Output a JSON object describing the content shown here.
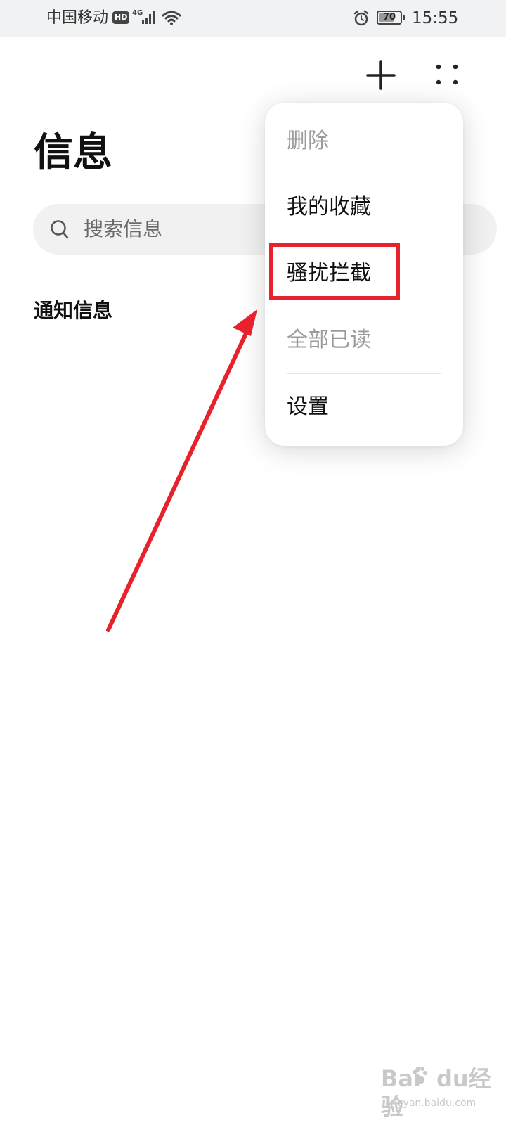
{
  "status_bar": {
    "carrier": "中国移动",
    "hd_badge": "HD",
    "network_type": "4G",
    "battery_level": "70",
    "battery_fraction": 0.7,
    "time": "15:55"
  },
  "header": {
    "add_icon": "plus-icon",
    "more_icon": "more-dots-icon"
  },
  "page": {
    "title": "信息",
    "search_placeholder": "搜索信息",
    "section_label": "通知信息"
  },
  "menu": {
    "items": [
      {
        "label": "删除",
        "enabled": false
      },
      {
        "label": "我的收藏",
        "enabled": true
      },
      {
        "label": "骚扰拦截",
        "enabled": true,
        "highlighted": true
      },
      {
        "label": "全部已读",
        "enabled": false
      },
      {
        "label": "设置",
        "enabled": true
      }
    ]
  },
  "annotation": {
    "color": "#e8222c"
  },
  "colors": {
    "text": "#111111",
    "disabled_text": "#9b9b9b",
    "search_bg": "#f1f1f1",
    "status_bar_bg": "#f1f2f3"
  },
  "watermark": {
    "brand": "Bai",
    "brand_suffix": "du",
    "product": "经验",
    "site": "jingyan.baidu.com"
  }
}
